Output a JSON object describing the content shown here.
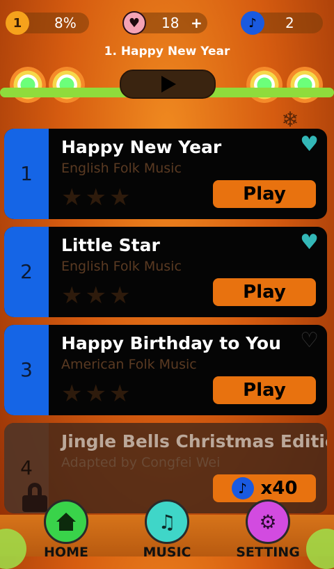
{
  "topbar": {
    "level": "1",
    "progress": "8%",
    "lives": "18",
    "lives_add": "+",
    "notes": "2"
  },
  "now_playing": "1. Happy New Year",
  "songs": [
    {
      "index": "1",
      "title": "Happy New Year",
      "subtitle": "English Folk Music",
      "favorited": true,
      "action": "Play"
    },
    {
      "index": "2",
      "title": "Little Star",
      "subtitle": "English Folk Music",
      "favorited": true,
      "action": "Play"
    },
    {
      "index": "3",
      "title": "Happy Birthday to You",
      "subtitle": "American Folk Music",
      "favorited": false,
      "action": "Play"
    },
    {
      "index": "4",
      "title": "Jingle Bells Christmas Edition",
      "subtitle": "Adapted by Congfei Wei",
      "locked": true,
      "cost": "x40"
    }
  ],
  "nav": {
    "home": "HOME",
    "music": "MUSIC",
    "setting": "SETTING"
  },
  "colors": {
    "accent": "#e8720f",
    "index_blue": "#1565e6",
    "heart_teal": "#33b7b7"
  }
}
